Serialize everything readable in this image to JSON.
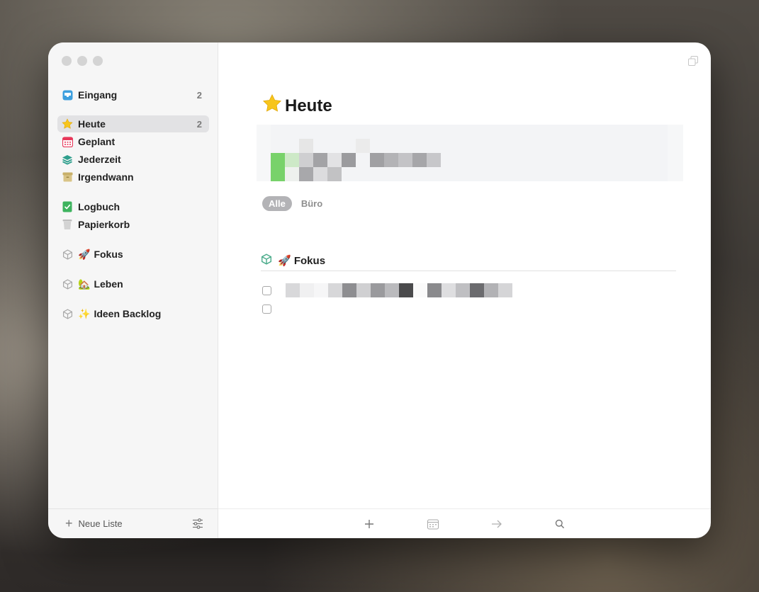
{
  "sidebar": {
    "inbox": {
      "label": "Eingang",
      "count": "2"
    },
    "items": [
      {
        "label": "Heute",
        "count": "2",
        "icon": "star-icon"
      },
      {
        "label": "Geplant",
        "icon": "calendar-icon"
      },
      {
        "label": "Jederzeit",
        "icon": "layers-icon"
      },
      {
        "label": "Irgendwann",
        "icon": "archive-box-icon"
      }
    ],
    "logbook": {
      "label": "Logbuch"
    },
    "trash": {
      "label": "Papierkorb"
    },
    "areas": [
      {
        "emoji": "🚀",
        "label": "Fokus"
      },
      {
        "emoji": "🏡",
        "label": "Leben"
      },
      {
        "emoji": "✨",
        "label": "Ideen Backlog"
      }
    ],
    "footer": {
      "new_list_label": "Neue Liste"
    }
  },
  "main": {
    "title": "Heute",
    "title_emoji": "⭐",
    "tags": [
      {
        "label": "Alle",
        "active": true
      },
      {
        "label": "Büro",
        "active": false
      }
    ],
    "section": {
      "emoji": "🚀",
      "label": "Fokus"
    }
  },
  "colors": {
    "accent": "#5aa9df",
    "section_icon": "#4aab8a",
    "selected_bg": "#e2e2e4"
  }
}
